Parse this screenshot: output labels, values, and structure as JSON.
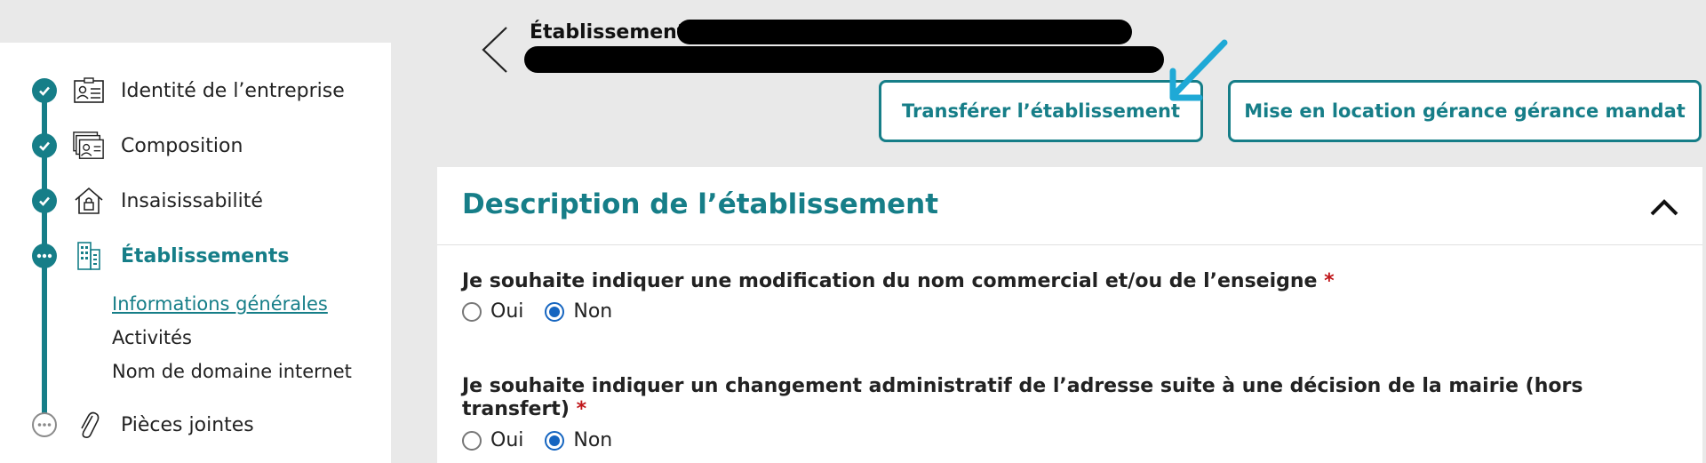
{
  "header": {
    "title": "Établissement -",
    "transfer_button": "Transférer l’établissement",
    "location_button": "Mise en location gérance gérance mandat"
  },
  "sidebar": {
    "steps": [
      {
        "label": "Identité de l’entreprise",
        "status": "done",
        "icon": "id-card-icon"
      },
      {
        "label": "Composition",
        "status": "done",
        "icon": "people-cards-icon"
      },
      {
        "label": "Insaisissabilité",
        "status": "done",
        "icon": "house-lock-icon"
      },
      {
        "label": "Établissements",
        "status": "current",
        "icon": "building-icon"
      },
      {
        "label": "Pièces jointes",
        "status": "todo",
        "icon": "paperclip-icon"
      }
    ],
    "substeps": [
      {
        "label": "Informations générales",
        "active": true
      },
      {
        "label": "Activités",
        "active": false
      },
      {
        "label": "Nom de domaine internet",
        "active": false
      }
    ]
  },
  "section": {
    "title": "Description de l’établissement",
    "questions": [
      {
        "text": "Je souhaite indiquer une modification du nom commercial et/ou de l’enseigne",
        "required_mark": "*",
        "options": [
          "Oui",
          "Non"
        ],
        "selected": "Non"
      },
      {
        "text": "Je souhaite indiquer un changement administratif de l’adresse suite à une décision de la mairie (hors transfert)",
        "required_mark": "*",
        "options": [
          "Oui",
          "Non"
        ],
        "selected": "Non"
      }
    ]
  },
  "colors": {
    "accent": "#167e88",
    "radio_selected": "#1565c0",
    "required": "#c0171b",
    "annotation_arrow": "#1fa9d6"
  }
}
